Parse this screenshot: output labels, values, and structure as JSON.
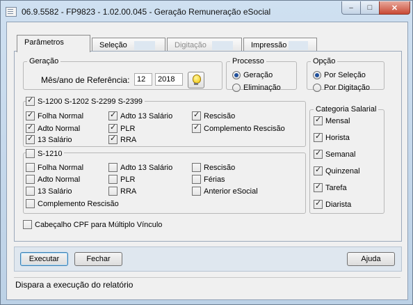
{
  "window": {
    "title": "06.9.5582 - FP9823 - 1.02.00.045 - Geração Remuneração eSocial",
    "minimize_glyph": "–",
    "maximize_glyph": "□",
    "close_glyph": "✕"
  },
  "tabs": [
    {
      "label": "Parâmetros",
      "state": "active"
    },
    {
      "label": "Seleção",
      "state": "normal"
    },
    {
      "label": "Digitação",
      "state": "disabled"
    },
    {
      "label": "Impressão",
      "state": "normal"
    }
  ],
  "geracao": {
    "legend": "Geração",
    "ref_label": "Mês/ano de Referência:",
    "month": "12",
    "year": "2018",
    "icon": "lightbulb-icon"
  },
  "processo": {
    "legend": "Processo",
    "options": [
      {
        "label": "Geração",
        "selected": true
      },
      {
        "label": "Eliminação",
        "selected": false
      }
    ]
  },
  "opcao": {
    "legend": "Opção",
    "options": [
      {
        "label": "Por Seleção",
        "selected": true
      },
      {
        "label": "Por Digitação",
        "selected": false
      }
    ]
  },
  "s1200": {
    "legend": "S-1200 S-1202 S-2299 S-2399",
    "checked": true,
    "items": [
      {
        "label": "Folha Normal",
        "checked": true
      },
      {
        "label": "Adto 13 Salário",
        "checked": true
      },
      {
        "label": "Rescisão",
        "checked": true
      },
      {
        "label": "Adto Normal",
        "checked": true
      },
      {
        "label": "PLR",
        "checked": true
      },
      {
        "label": "Complemento Rescisão",
        "checked": true
      },
      {
        "label": "13 Salário",
        "checked": true
      },
      {
        "label": "RRA",
        "checked": true
      }
    ]
  },
  "s1210": {
    "legend": "S-1210",
    "checked": false,
    "items": [
      {
        "label": "Folha Normal",
        "checked": false
      },
      {
        "label": "Adto 13 Salário",
        "checked": false
      },
      {
        "label": "Rescisão",
        "checked": false
      },
      {
        "label": "Adto Normal",
        "checked": false
      },
      {
        "label": "PLR",
        "checked": false
      },
      {
        "label": "Férias",
        "checked": false
      },
      {
        "label": "13 Salário",
        "checked": false
      },
      {
        "label": "RRA",
        "checked": false
      },
      {
        "label": "Anterior eSocial",
        "checked": false
      },
      {
        "label": "Complemento Rescisão",
        "checked": false
      }
    ]
  },
  "categoria": {
    "legend": "Categoria Salarial",
    "items": [
      {
        "label": "Mensal",
        "checked": true
      },
      {
        "label": "Horista",
        "checked": true
      },
      {
        "label": "Semanal",
        "checked": true
      },
      {
        "label": "Quinzenal",
        "checked": true
      },
      {
        "label": "Tarefa",
        "checked": true
      },
      {
        "label": "Diarista",
        "checked": true
      }
    ]
  },
  "cabecalho": {
    "label": "Cabeçalho CPF para Múltiplo Vínculo",
    "checked": false
  },
  "buttons": {
    "execute": "Executar",
    "close": "Fechar",
    "help": "Ajuda"
  },
  "status": "Dispara a execução do relatório"
}
